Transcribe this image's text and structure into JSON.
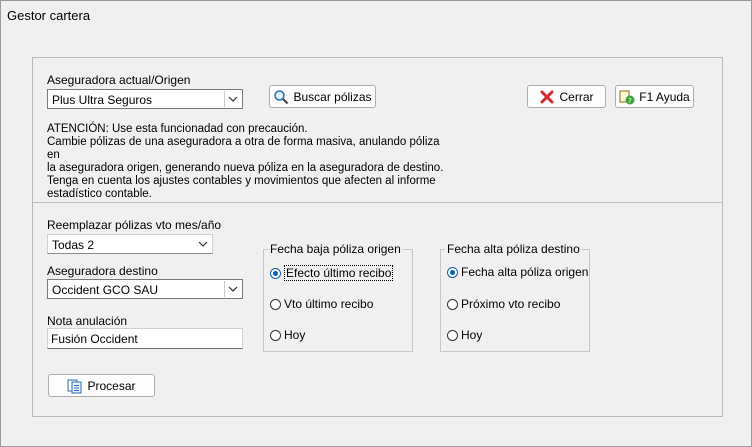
{
  "window": {
    "title": "Gestor cartera"
  },
  "top": {
    "origin_label": "Aseguradora actual/Origen",
    "origin_value": "Plus Ultra Seguros",
    "search_button": "Buscar pólizas",
    "close_button": "Cerrar",
    "help_button": "F1 Ayuda",
    "notice_lines": [
      "ATENCIÓN: Use esta funcionadad con precaución.",
      "Cambie pólizas de una aseguradora a otra de forma masiva, anulando póliza en",
      "la aseguradora origen, generando nueva póliza en la aseguradora de destino.",
      "Tenga en cuenta los ajustes contables y movimientos que afecten al informe",
      "estadístico contable."
    ]
  },
  "bottom": {
    "replace_label": "Reemplazar pólizas vto mes/año",
    "replace_value": "Todas 2",
    "dest_label": "Aseguradora destino",
    "dest_value": "Occident GCO SAU",
    "note_label": "Nota anulación",
    "note_value": "Fusión Occident",
    "process_button": "Procesar",
    "baja_group": {
      "title": "Fecha baja póliza origen",
      "options": [
        "Efecto último recibo",
        "Vto último recibo",
        "Hoy"
      ],
      "selected_index": 0
    },
    "alta_group": {
      "title": "Fecha alta póliza destino",
      "options": [
        "Fecha alta póliza origen",
        "Próximo vto recibo",
        "Hoy"
      ],
      "selected_index": 0
    }
  },
  "colors": {
    "accent": "#0b5fb7",
    "background": "#f0f0f0"
  },
  "icons": {
    "search": "magnifier-icon",
    "close": "red-x-icon",
    "help": "help-icon",
    "process": "documents-icon"
  }
}
